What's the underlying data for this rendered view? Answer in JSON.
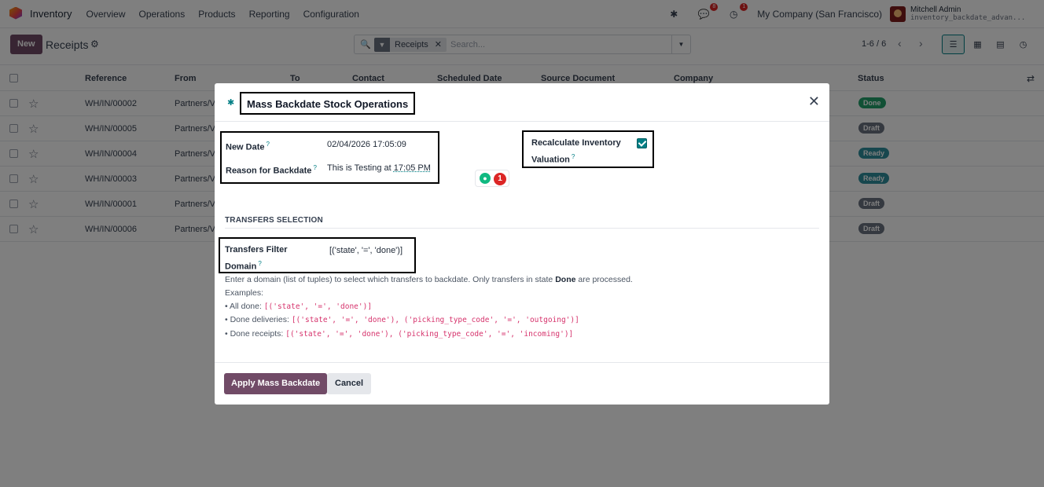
{
  "navbar": {
    "app_name": "Inventory",
    "menu": [
      "Overview",
      "Operations",
      "Products",
      "Reporting",
      "Configuration"
    ],
    "chat_badge": "8",
    "activity_badge": "1",
    "company": "My Company (San Francisco)",
    "user_name": "Mitchell Admin",
    "user_db": "inventory_backdate_advan..."
  },
  "control": {
    "new_label": "New",
    "breadcrumb": "Receipts",
    "facet_label": "Receipts",
    "search_placeholder": "Search...",
    "pager": "1-6 / 6"
  },
  "list": {
    "columns": [
      "Reference",
      "From",
      "To",
      "Contact",
      "Scheduled Date",
      "Source Document",
      "Company",
      "Status"
    ],
    "rows": [
      {
        "ref": "WH/IN/00002",
        "from": "Partners/V",
        "status": "Done"
      },
      {
        "ref": "WH/IN/00005",
        "from": "Partners/V",
        "status": "Draft"
      },
      {
        "ref": "WH/IN/00004",
        "from": "Partners/V",
        "status": "Ready"
      },
      {
        "ref": "WH/IN/00003",
        "from": "Partners/V",
        "status": "Ready"
      },
      {
        "ref": "WH/IN/00001",
        "from": "Partners/V",
        "status": "Draft"
      },
      {
        "ref": "WH/IN/00006",
        "from": "Partners/V",
        "status": "Draft"
      }
    ]
  },
  "dialog": {
    "title": "Mass Backdate Stock Operations",
    "new_date_label": "New Date",
    "new_date_value": "02/04/2026 17:05:09",
    "reason_label": "Reason for Backdate",
    "reason_value_prefix": "This is Testing at ",
    "reason_value_time": "17:05 PM",
    "recalc_label_line1": "Recalculate Inventory",
    "recalc_label_line2": "Valuation",
    "recalc_checked": true,
    "assist_count": "1",
    "section_title": "TRANSFERS SELECTION",
    "domain_label_line1": "Transfers Filter",
    "domain_label_line2": "Domain",
    "domain_value": "[('state', '=', 'done')]",
    "help_intro_before": "Enter a domain (list of tuples) to select which transfers to backdate. Only transfers in state ",
    "help_intro_bold": "Done",
    "help_intro_after": " are processed.",
    "help_examples": "Examples:",
    "ex1_label": "• All done: ",
    "ex1_code": "[('state', '=', 'done')]",
    "ex2_label": "• Done deliveries: ",
    "ex2_code": "[('state', '=', 'done'), ('picking_type_code', '=', 'outgoing')]",
    "ex3_label": "• Done receipts: ",
    "ex3_code": "[('state', '=', 'done'), ('picking_type_code', '=', 'incoming')]",
    "apply_label": "Apply Mass Backdate",
    "cancel_label": "Cancel",
    "question_mark": "?"
  },
  "colors": {
    "primary": "#714b67",
    "accent": "#017e84"
  }
}
